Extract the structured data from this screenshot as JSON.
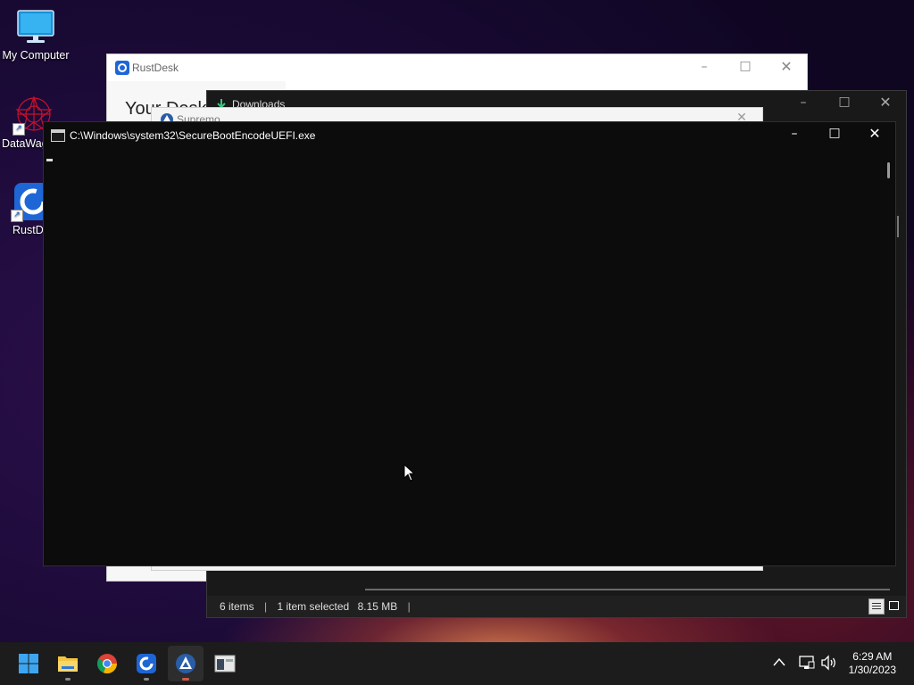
{
  "desktop": {
    "icons": [
      {
        "label": "My Computer"
      },
      {
        "label": "DataWag"
      },
      {
        "label": "RustDe"
      }
    ]
  },
  "windows": {
    "rustdesk": {
      "title": "RustDesk",
      "heading": "Your Desk"
    },
    "downloads": {
      "title": "Downloads",
      "status": {
        "items": "6 items",
        "selected": "1 item selected",
        "size": "8.15 MB"
      }
    },
    "supremo": {
      "title": "Supremo"
    },
    "console": {
      "title": "C:\\Windows\\system32\\SecureBootEncodeUEFI.exe"
    }
  },
  "taskbar": {
    "apps": [
      {
        "name": "Start",
        "icon": "windows-start-icon"
      },
      {
        "name": "File Explorer",
        "icon": "folder-icon"
      },
      {
        "name": "Google Chrome",
        "icon": "chrome-icon"
      },
      {
        "name": "RustDesk",
        "icon": "rustdesk-icon"
      },
      {
        "name": "Supremo",
        "icon": "supremo-icon",
        "active": true
      },
      {
        "name": "Console",
        "icon": "console-app-icon"
      }
    ],
    "clock": {
      "time": "6:29 AM",
      "date": "1/30/2023"
    }
  },
  "colors": {
    "accent": "#1e66d6",
    "console_bg": "#0c0c0c",
    "active_indicator": "#d0584a"
  }
}
